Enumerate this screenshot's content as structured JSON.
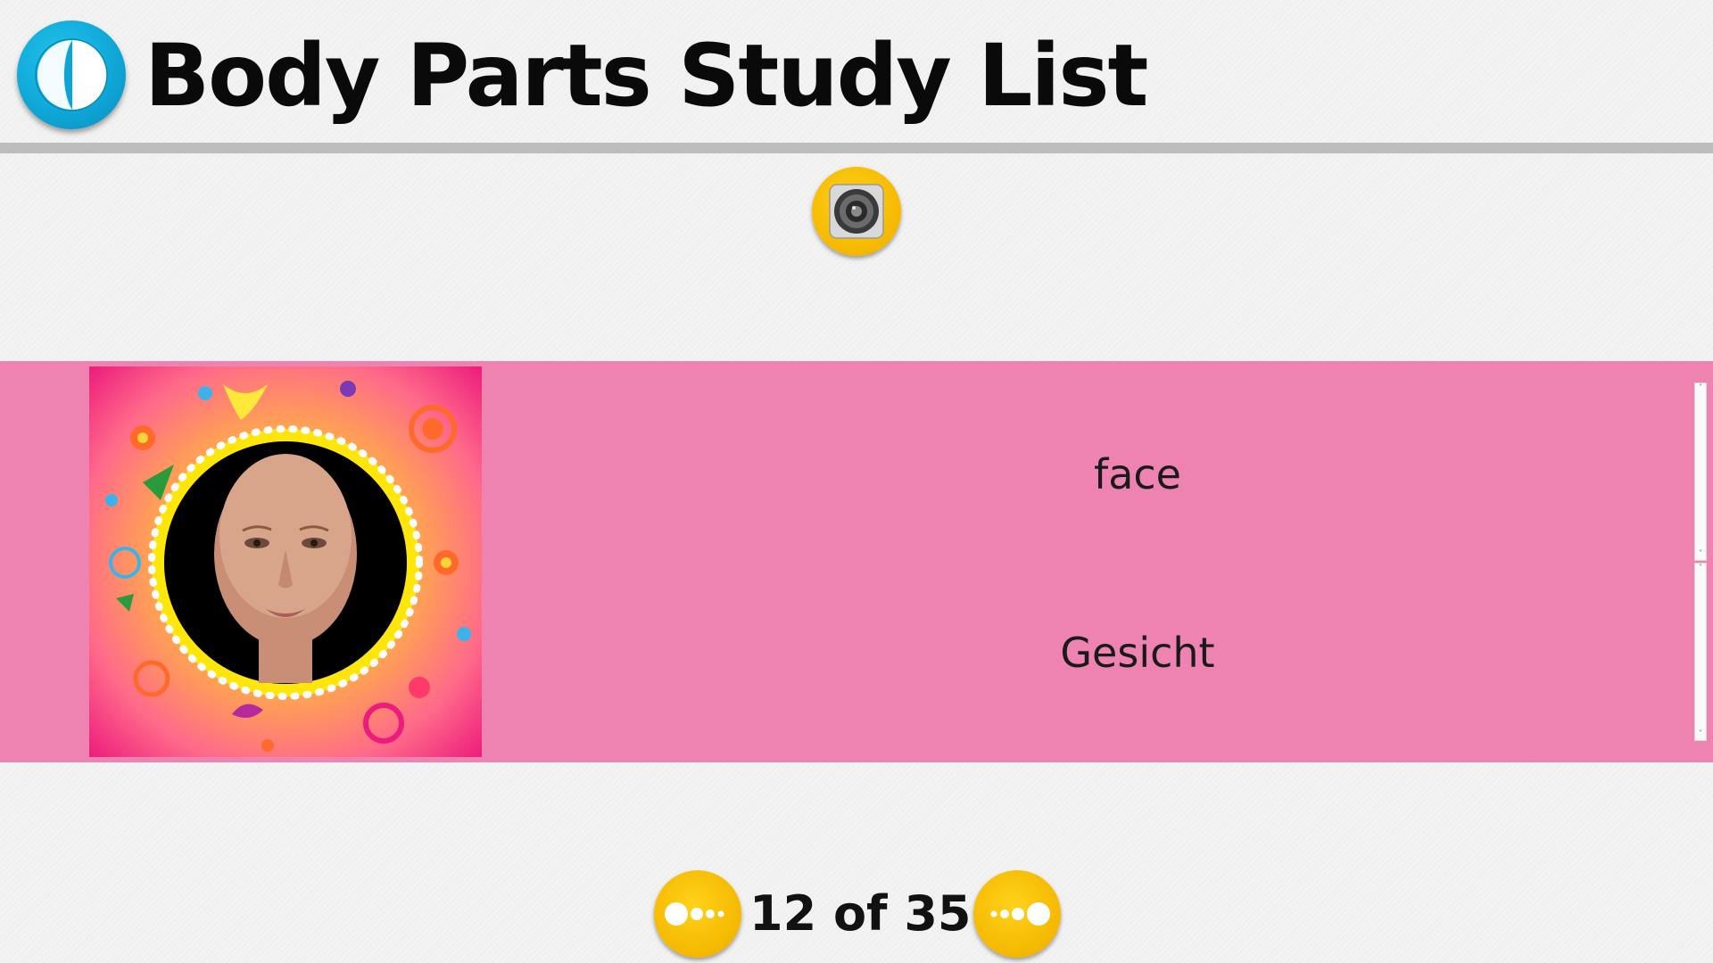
{
  "header": {
    "title": "Body Parts Study List",
    "back_icon": "back-arrow-icon"
  },
  "audio": {
    "icon": "speaker-icon"
  },
  "card": {
    "image_icon": "face-portrait",
    "english": "face",
    "german": "Gesicht"
  },
  "pagination": {
    "counter": "12 of 35",
    "current": 12,
    "total": 35,
    "prev_icon": "previous-dots-icon",
    "next_icon": "next-dots-icon"
  },
  "colors": {
    "band": "#ee82b1",
    "back_button": "#0ea5d5",
    "nav_buttons": "#f5b800",
    "rule": "#bdbdbd"
  }
}
